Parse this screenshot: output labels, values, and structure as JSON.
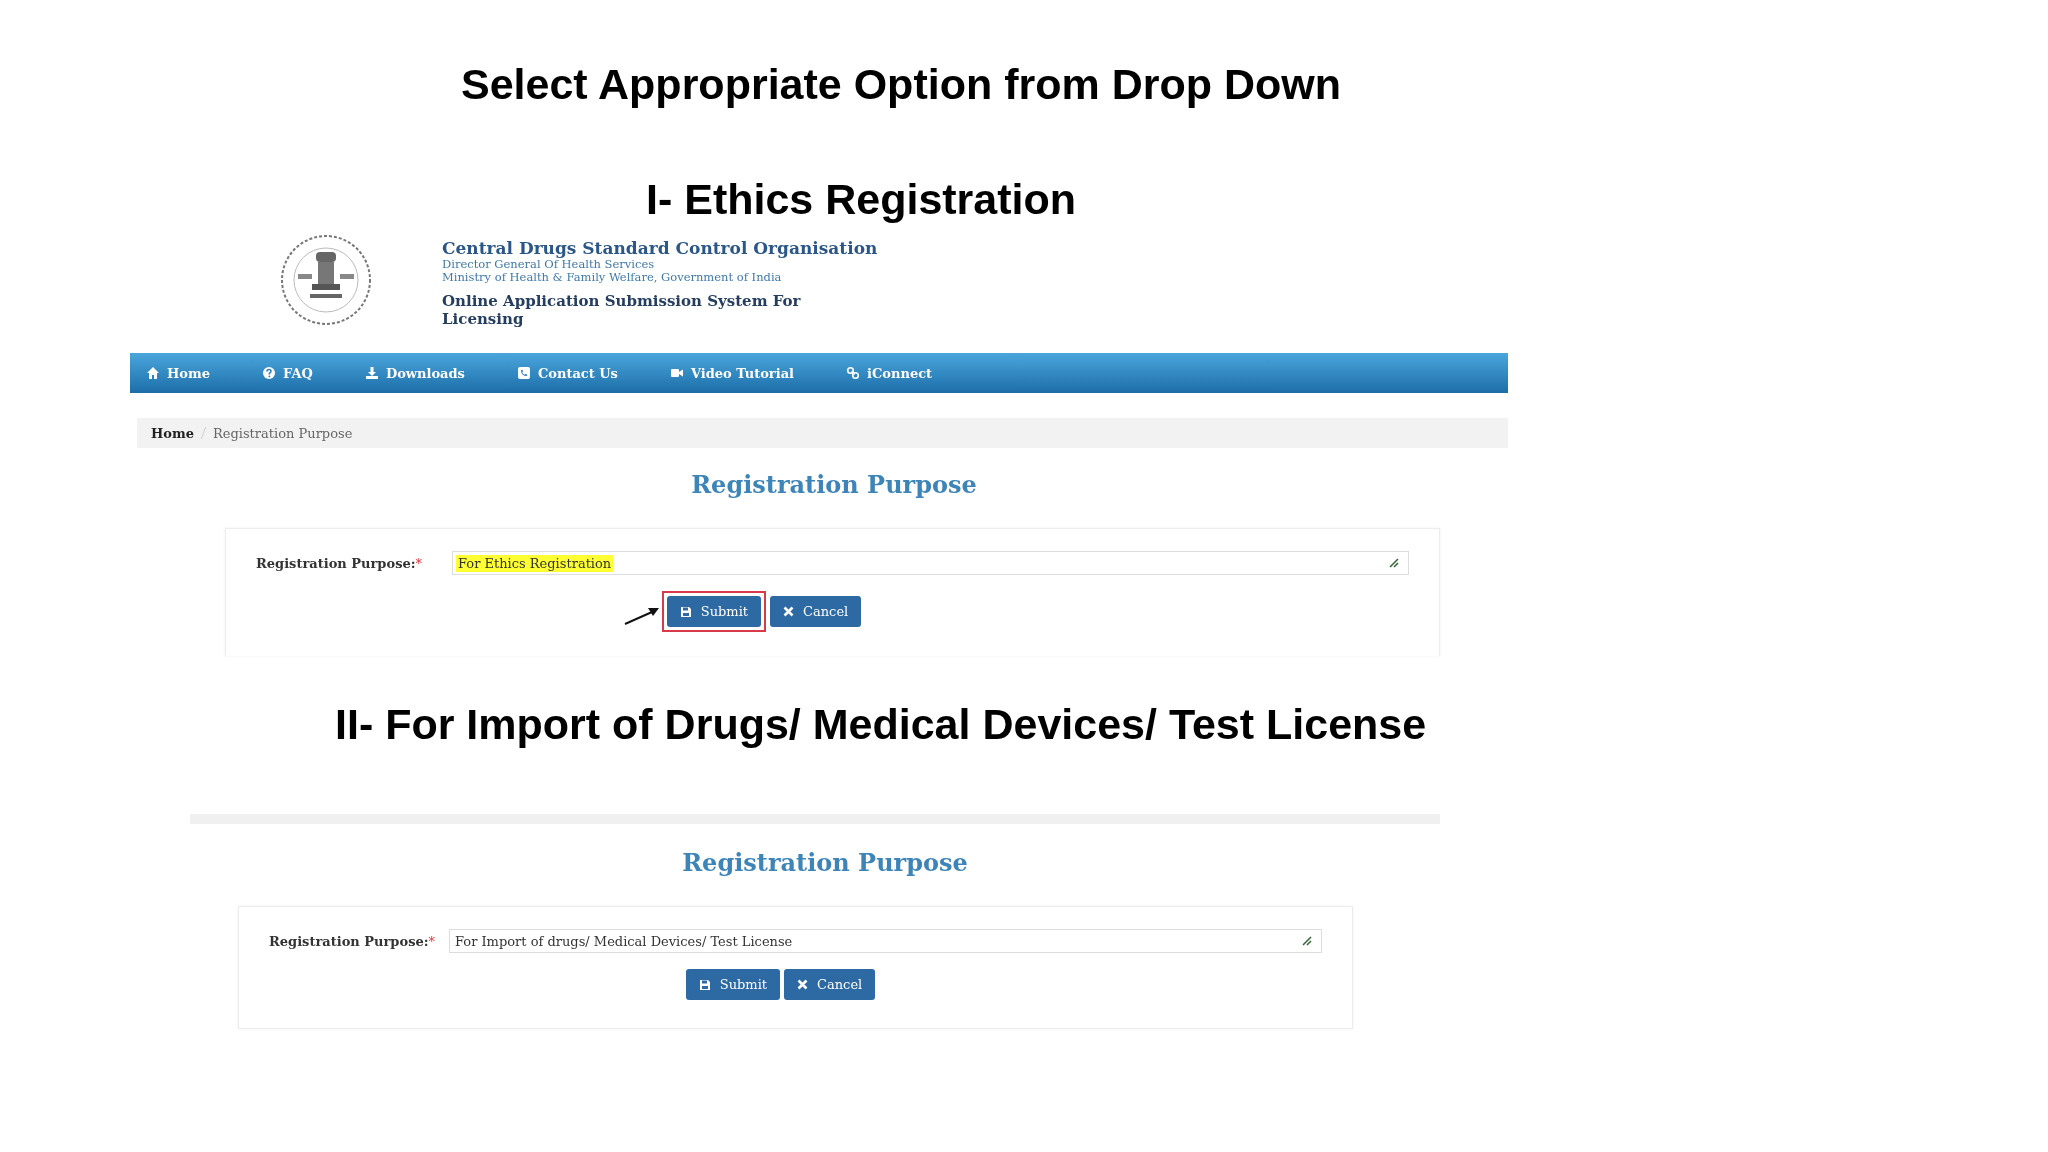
{
  "slide": {
    "title": "Select Appropriate Option from Drop Down"
  },
  "sections": [
    {
      "heading": "I- Ethics Registration",
      "screenshot": {
        "header": {
          "organisation": "Central Drugs Standard Control Organisation",
          "department": "Director General Of Health Services",
          "ministry": "Ministry of Health & Family Welfare, Government of India",
          "system": "Online Application Submission System For Licensing"
        },
        "nav": [
          {
            "kind": "home",
            "label": "Home"
          },
          {
            "kind": "faq",
            "label": "FAQ"
          },
          {
            "kind": "downloads",
            "label": "Downloads"
          },
          {
            "kind": "contact",
            "label": "Contact Us"
          },
          {
            "kind": "video",
            "label": "Video Tutorial"
          },
          {
            "kind": "link",
            "label": "iConnect"
          }
        ],
        "breadcrumb": [
          "Home",
          "Registration Purpose"
        ],
        "page_title": "Registration Purpose",
        "form": {
          "label": "Registration Purpose:",
          "required_mark": "*",
          "value": "For Ethics Registration",
          "highlighted": true,
          "buttons": [
            {
              "kind": "submit",
              "label": "Submit",
              "annotated": true
            },
            {
              "kind": "cancel",
              "label": "Cancel",
              "annotated": false
            }
          ]
        }
      }
    },
    {
      "heading": "II- For Import of Drugs/ Medical Devices/ Test License",
      "screenshot": {
        "page_title": "Registration Purpose",
        "form": {
          "label": "Registration Purpose:",
          "required_mark": "*",
          "value": "For Import of drugs/ Medical Devices/ Test License",
          "highlighted": false,
          "buttons": [
            {
              "kind": "submit",
              "label": "Submit",
              "annotated": false
            },
            {
              "kind": "cancel",
              "label": "Cancel",
              "annotated": false
            }
          ]
        }
      }
    }
  ]
}
